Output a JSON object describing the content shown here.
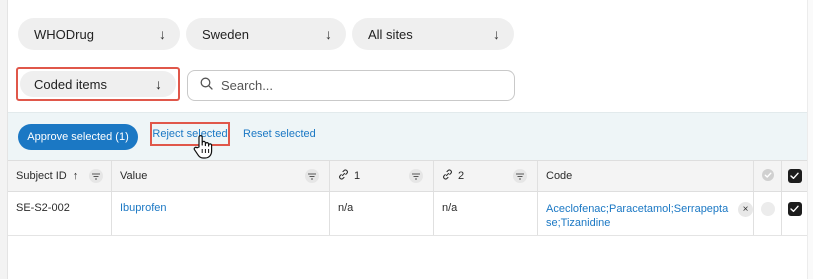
{
  "filters": {
    "dictionary": {
      "label": "WHODrug",
      "arrow": "↓"
    },
    "country": {
      "label": "Sweden",
      "arrow": "↓"
    },
    "site": {
      "label": "All sites",
      "arrow": "↓"
    }
  },
  "status_select": {
    "label": "Coded items",
    "arrow": "↓"
  },
  "search": {
    "placeholder": "Search..."
  },
  "actions": {
    "approve_label": "Approve selected (1)",
    "reject_label": "Reject selected",
    "reset_label": "Reset selected"
  },
  "table": {
    "columns": {
      "subject_id": "Subject ID",
      "sort_arrow": "↑",
      "value": "Value",
      "link1": "1",
      "link2": "2",
      "code": "Code"
    },
    "rows": [
      {
        "subject_id": "SE-S2-002",
        "value": "Ibuprofen",
        "link1": "n/a",
        "link2": "n/a",
        "code": "Aceclofenac;Paracetamol;Serrapeptase;Tizanidine",
        "code_line1": "Aceclofenac;Paracetamol;Serrapepta",
        "code_line2": "se;Tizanidine",
        "remove": "×"
      }
    ]
  },
  "colors": {
    "accent": "#1b78c4",
    "highlight": "#e0574a",
    "action_bar": "#eef5f7"
  }
}
